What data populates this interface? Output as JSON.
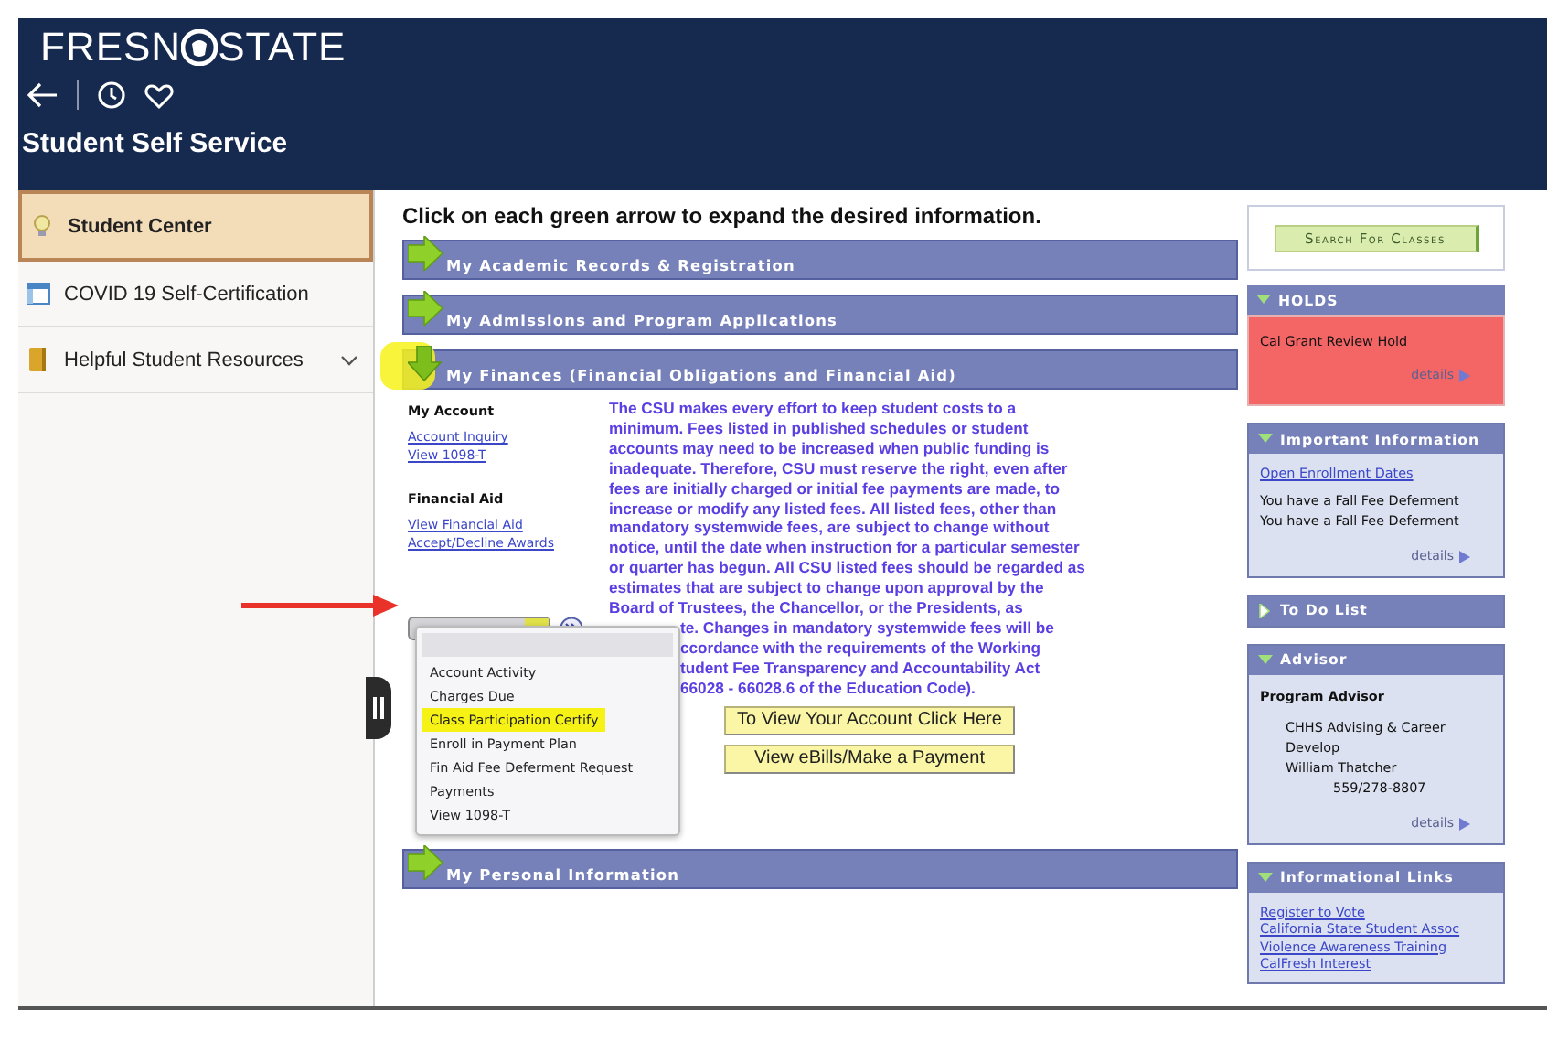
{
  "header": {
    "logo_left": "FRESN",
    "logo_right": "STATE",
    "title": "Student Self Service"
  },
  "sidebar": {
    "items": [
      {
        "label": "Student Center",
        "kind": "bulb",
        "selected": true,
        "expandable": false
      },
      {
        "label": "COVID 19 Self-Certification",
        "kind": "form",
        "selected": false,
        "expandable": false
      },
      {
        "label": "Helpful Student Resources",
        "kind": "folder",
        "selected": false,
        "expandable": true
      }
    ]
  },
  "main": {
    "instruction": "Click on each green arrow to expand the desired information.",
    "sections": [
      {
        "title": "My Academic Records & Registration",
        "expanded": false,
        "highlighted": false
      },
      {
        "title": "My Admissions and Program Applications",
        "expanded": false,
        "highlighted": false
      },
      {
        "title": "My Finances (Financial Obligations and Financial Aid)",
        "expanded": true,
        "highlighted": true
      },
      {
        "title": "My Personal Information",
        "expanded": false,
        "highlighted": false
      }
    ],
    "finances": {
      "account_heading": "My Account",
      "account_links": [
        "Account Inquiry",
        "View 1098-T"
      ],
      "aid_heading": "Financial Aid",
      "aid_links": [
        "View Financial Aid",
        "Accept/Decline Awards"
      ],
      "paragraph_lines": [
        "The CSU makes every effort to keep student costs to a",
        "minimum. Fees listed in published schedules or student",
        "accounts may need to be increased when public funding is",
        "inadequate. Therefore, CSU must reserve the right, even after",
        "fees are initially charged or initial fee payments are made, to",
        "increase or modify any listed fees. All listed fees, other than",
        "mandatory systemwide fees, are subject to change without",
        "notice, until the date when instruction for a particular semester",
        "or quarter has begun. All CSU listed fees should be regarded as",
        "estimates that are subject to change upon approval by the",
        "Board of Trustees, the Chancellor, or the Presidents, as"
      ],
      "covered_lines": [
        "te. Changes in mandatory systemwide fees will be",
        "ccordance with the requirements of the Working",
        "tudent Fee Transparency and Accountability Act",
        "66028 - 66028.6 of the Education Code)."
      ],
      "dropdown": {
        "open": true,
        "options": [
          {
            "label": "Account Activity",
            "highlighted": false
          },
          {
            "label": "Charges Due",
            "highlighted": false
          },
          {
            "label": "Class Participation Certify",
            "highlighted": true
          },
          {
            "label": "Enroll in Payment Plan",
            "highlighted": false
          },
          {
            "label": "Fin Aid Fee Deferment Request",
            "highlighted": false
          },
          {
            "label": "Payments",
            "highlighted": false
          },
          {
            "label": "View 1098-T",
            "highlighted": false
          }
        ]
      },
      "buttons": [
        "To View Your Account Click Here",
        "View eBills/Make a Payment"
      ]
    }
  },
  "right": {
    "search_button": "Search For Classes",
    "panels": [
      {
        "title": "HOLDS",
        "expanded": true,
        "alert": true,
        "items": [
          "Cal Grant Review Hold"
        ],
        "details": "details"
      },
      {
        "title": "Important Information",
        "expanded": true,
        "alert": false,
        "links": [
          "Open Enrollment Dates"
        ],
        "items": [
          "You have a Fall Fee Deferment",
          "You have a Fall Fee Deferment"
        ],
        "details": "details"
      },
      {
        "title": "To Do List",
        "expanded": false,
        "alert": false
      },
      {
        "title": "Advisor",
        "expanded": true,
        "alert": false,
        "heading": "Program Advisor",
        "items": [
          "CHHS Advising & Career",
          "Develop",
          "William Thatcher"
        ],
        "phone": "559/278-8807",
        "details": "details"
      },
      {
        "title": "Informational Links",
        "expanded": true,
        "alert": false,
        "links": [
          "Register to Vote",
          "California State Student Assoc",
          "Violence Awareness Training",
          "CalFresh Interest"
        ]
      }
    ]
  }
}
